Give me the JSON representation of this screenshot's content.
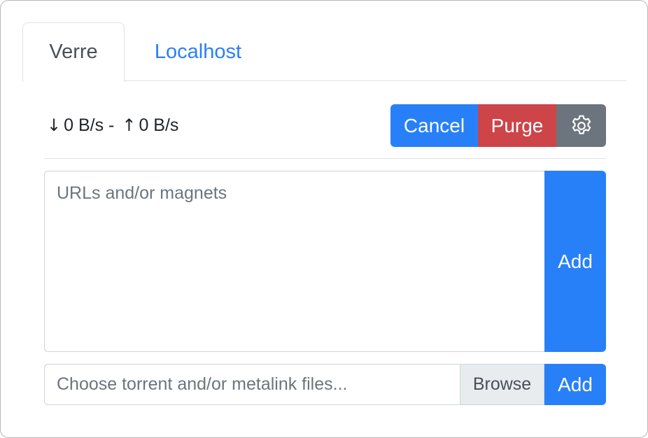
{
  "tabs": [
    {
      "label": "Verre",
      "active": true
    },
    {
      "label": "Localhost",
      "active": false
    }
  ],
  "stats": {
    "down_icon": "down-arrow-icon",
    "down_arrow": "↓",
    "down_speed": "0 B/s",
    "separator": "-",
    "up_icon": "up-arrow-icon",
    "up_arrow": "↑",
    "up_speed": "0 B/s"
  },
  "actions": {
    "cancel_label": "Cancel",
    "purge_label": "Purge",
    "settings_icon": "gear-icon"
  },
  "url_input": {
    "placeholder": "URLs and/or magnets",
    "value": "",
    "add_label": "Add"
  },
  "file_input": {
    "placeholder": "Choose torrent and/or metalink files...",
    "browse_label": "Browse",
    "add_label": "Add"
  },
  "colors": {
    "primary": "#2880f8",
    "danger": "#cd4449",
    "secondary": "#6c757d",
    "tab_link": "#2880f8"
  }
}
